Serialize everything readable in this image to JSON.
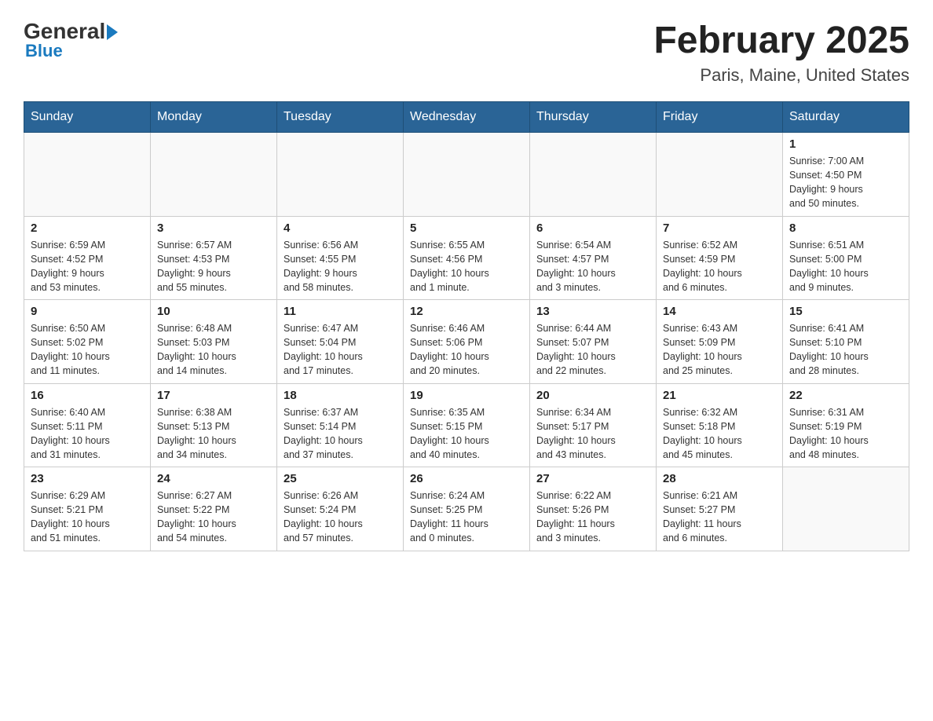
{
  "header": {
    "logo_general": "General",
    "logo_blue": "Blue",
    "month_title": "February 2025",
    "location": "Paris, Maine, United States"
  },
  "weekdays": [
    "Sunday",
    "Monday",
    "Tuesday",
    "Wednesday",
    "Thursday",
    "Friday",
    "Saturday"
  ],
  "weeks": [
    [
      {
        "day": "",
        "info": ""
      },
      {
        "day": "",
        "info": ""
      },
      {
        "day": "",
        "info": ""
      },
      {
        "day": "",
        "info": ""
      },
      {
        "day": "",
        "info": ""
      },
      {
        "day": "",
        "info": ""
      },
      {
        "day": "1",
        "info": "Sunrise: 7:00 AM\nSunset: 4:50 PM\nDaylight: 9 hours\nand 50 minutes."
      }
    ],
    [
      {
        "day": "2",
        "info": "Sunrise: 6:59 AM\nSunset: 4:52 PM\nDaylight: 9 hours\nand 53 minutes."
      },
      {
        "day": "3",
        "info": "Sunrise: 6:57 AM\nSunset: 4:53 PM\nDaylight: 9 hours\nand 55 minutes."
      },
      {
        "day": "4",
        "info": "Sunrise: 6:56 AM\nSunset: 4:55 PM\nDaylight: 9 hours\nand 58 minutes."
      },
      {
        "day": "5",
        "info": "Sunrise: 6:55 AM\nSunset: 4:56 PM\nDaylight: 10 hours\nand 1 minute."
      },
      {
        "day": "6",
        "info": "Sunrise: 6:54 AM\nSunset: 4:57 PM\nDaylight: 10 hours\nand 3 minutes."
      },
      {
        "day": "7",
        "info": "Sunrise: 6:52 AM\nSunset: 4:59 PM\nDaylight: 10 hours\nand 6 minutes."
      },
      {
        "day": "8",
        "info": "Sunrise: 6:51 AM\nSunset: 5:00 PM\nDaylight: 10 hours\nand 9 minutes."
      }
    ],
    [
      {
        "day": "9",
        "info": "Sunrise: 6:50 AM\nSunset: 5:02 PM\nDaylight: 10 hours\nand 11 minutes."
      },
      {
        "day": "10",
        "info": "Sunrise: 6:48 AM\nSunset: 5:03 PM\nDaylight: 10 hours\nand 14 minutes."
      },
      {
        "day": "11",
        "info": "Sunrise: 6:47 AM\nSunset: 5:04 PM\nDaylight: 10 hours\nand 17 minutes."
      },
      {
        "day": "12",
        "info": "Sunrise: 6:46 AM\nSunset: 5:06 PM\nDaylight: 10 hours\nand 20 minutes."
      },
      {
        "day": "13",
        "info": "Sunrise: 6:44 AM\nSunset: 5:07 PM\nDaylight: 10 hours\nand 22 minutes."
      },
      {
        "day": "14",
        "info": "Sunrise: 6:43 AM\nSunset: 5:09 PM\nDaylight: 10 hours\nand 25 minutes."
      },
      {
        "day": "15",
        "info": "Sunrise: 6:41 AM\nSunset: 5:10 PM\nDaylight: 10 hours\nand 28 minutes."
      }
    ],
    [
      {
        "day": "16",
        "info": "Sunrise: 6:40 AM\nSunset: 5:11 PM\nDaylight: 10 hours\nand 31 minutes."
      },
      {
        "day": "17",
        "info": "Sunrise: 6:38 AM\nSunset: 5:13 PM\nDaylight: 10 hours\nand 34 minutes."
      },
      {
        "day": "18",
        "info": "Sunrise: 6:37 AM\nSunset: 5:14 PM\nDaylight: 10 hours\nand 37 minutes."
      },
      {
        "day": "19",
        "info": "Sunrise: 6:35 AM\nSunset: 5:15 PM\nDaylight: 10 hours\nand 40 minutes."
      },
      {
        "day": "20",
        "info": "Sunrise: 6:34 AM\nSunset: 5:17 PM\nDaylight: 10 hours\nand 43 minutes."
      },
      {
        "day": "21",
        "info": "Sunrise: 6:32 AM\nSunset: 5:18 PM\nDaylight: 10 hours\nand 45 minutes."
      },
      {
        "day": "22",
        "info": "Sunrise: 6:31 AM\nSunset: 5:19 PM\nDaylight: 10 hours\nand 48 minutes."
      }
    ],
    [
      {
        "day": "23",
        "info": "Sunrise: 6:29 AM\nSunset: 5:21 PM\nDaylight: 10 hours\nand 51 minutes."
      },
      {
        "day": "24",
        "info": "Sunrise: 6:27 AM\nSunset: 5:22 PM\nDaylight: 10 hours\nand 54 minutes."
      },
      {
        "day": "25",
        "info": "Sunrise: 6:26 AM\nSunset: 5:24 PM\nDaylight: 10 hours\nand 57 minutes."
      },
      {
        "day": "26",
        "info": "Sunrise: 6:24 AM\nSunset: 5:25 PM\nDaylight: 11 hours\nand 0 minutes."
      },
      {
        "day": "27",
        "info": "Sunrise: 6:22 AM\nSunset: 5:26 PM\nDaylight: 11 hours\nand 3 minutes."
      },
      {
        "day": "28",
        "info": "Sunrise: 6:21 AM\nSunset: 5:27 PM\nDaylight: 11 hours\nand 6 minutes."
      },
      {
        "day": "",
        "info": ""
      }
    ]
  ]
}
